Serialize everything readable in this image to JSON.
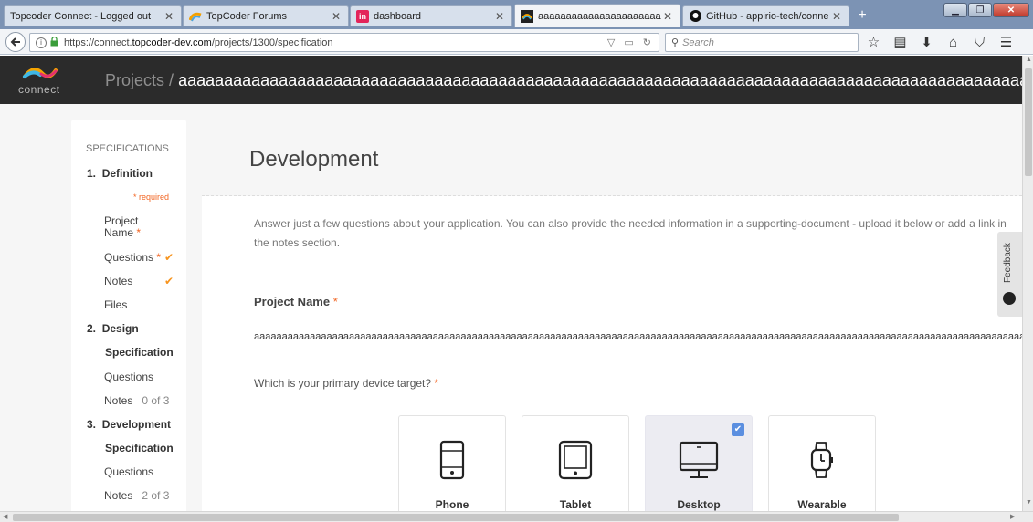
{
  "browser": {
    "tabs": [
      {
        "label": "Topcoder Connect - Logged out",
        "icon": "topcoder-icon"
      },
      {
        "label": "TopCoder Forums",
        "icon": "topcoder-forums-icon"
      },
      {
        "label": "dashboard",
        "icon": "invision-icon"
      },
      {
        "label": "aaaaaaaaaaaaaaaaaaaaaaaaaaa",
        "icon": "connect-icon"
      },
      {
        "label": "GitHub - appirio-tech/conne",
        "icon": "github-icon"
      }
    ],
    "active_tab_index": 3,
    "url_prefix": "https://connect.",
    "url_domain": "topcoder-dev.com",
    "url_path": "/projects/1300/specification",
    "search_placeholder": "Search"
  },
  "header": {
    "logo_text": "connect",
    "breadcrumb_root": "Projects",
    "breadcrumb_sep": "/",
    "project_title": "aaaaaaaaaaaaaaaaaaaaaaaaaaaaaaaaaaaaaaaaaaaaaaaaaaaaaaaaaaaaaaaaaaaaaaaaaaaaaaaaaaaaaaaaaaaaaaaaaaaaaaaaaaaaaaaaaaaaaaaaaaaaaaaaaaaaaaaa"
  },
  "sidebar": {
    "heading": "SPECIFICATIONS",
    "sections": [
      {
        "number": "1.",
        "title": "Definition",
        "required_note": "* required",
        "items": [
          {
            "label": "Project Name",
            "required": true,
            "done": false
          },
          {
            "label": "Questions",
            "required": true,
            "done": true
          },
          {
            "label": "Notes",
            "required": false,
            "done": true
          },
          {
            "label": "Files",
            "required": false,
            "done": false
          }
        ]
      },
      {
        "number": "2.",
        "title": "Design",
        "title_line2": "Specification",
        "items": [
          {
            "label": "Questions"
          },
          {
            "label": "Notes",
            "count": "0 of 3"
          }
        ]
      },
      {
        "number": "3.",
        "title": "Development",
        "title_line2": "Specification",
        "items": [
          {
            "label": "Questions"
          },
          {
            "label": "Notes",
            "count": "2 of 3"
          }
        ]
      }
    ]
  },
  "main": {
    "title": "Development",
    "intro": "Answer just a few questions about your application. You can also provide the needed information in a supporting-document - upload it below or add a link in the notes section.",
    "project_name_label": "Project Name",
    "required_star": "*",
    "project_name_value": "aaaaaaaaaaaaaaaaaaaaaaaaaaaaaaaaaaaaaaaaaaaaaaaaaaaaaaaaaaaaaaaaaaaaaaaaaaaaaaaaaaaaaaaaaaaaaaaaaaaaaaaaaaaaaaaaaaaaaaaaaaaaaaaaaaaaaaaaaaaaaaaaaaaaaaaaaaaaaaaaa",
    "device_question": "Which is your primary device target?",
    "devices": [
      {
        "label": "Phone",
        "icon": "phone-icon",
        "selected": false
      },
      {
        "label": "Tablet",
        "icon": "tablet-icon",
        "selected": false
      },
      {
        "label": "Desktop",
        "icon": "desktop-icon",
        "selected": true
      },
      {
        "label": "Wearable",
        "icon": "watch-icon",
        "selected": false
      }
    ]
  },
  "feedback_label": "Feedback",
  "colors": {
    "accent": "#f26522",
    "check": "#f7941e",
    "topnav": "#2b2b2b",
    "selected_card": "#ececf2"
  }
}
